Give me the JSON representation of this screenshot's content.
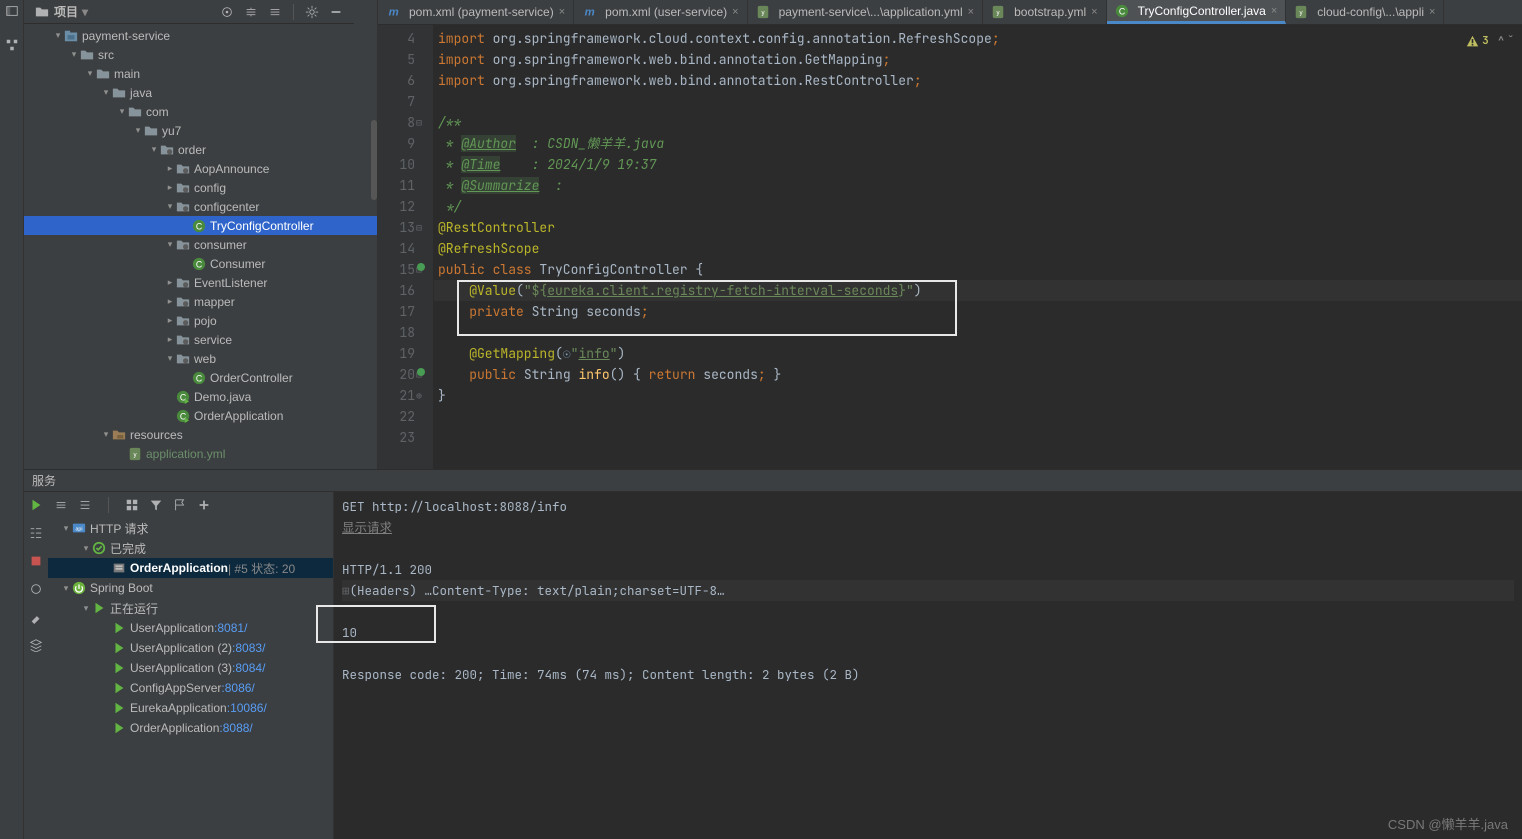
{
  "toolbar": {
    "project_label": "项目"
  },
  "warning_count": "3",
  "project_tree": [
    {
      "d": 0,
      "exp": "▾",
      "icon": "module",
      "label": "payment-service",
      "cls": ""
    },
    {
      "d": 1,
      "exp": "▾",
      "icon": "dir",
      "label": "src",
      "cls": ""
    },
    {
      "d": 2,
      "exp": "▾",
      "icon": "dir",
      "label": "main",
      "cls": ""
    },
    {
      "d": 3,
      "exp": "▾",
      "icon": "dir",
      "label": "java",
      "cls": ""
    },
    {
      "d": 4,
      "exp": "▾",
      "icon": "dir",
      "label": "com",
      "cls": ""
    },
    {
      "d": 5,
      "exp": "▾",
      "icon": "dir",
      "label": "yu7",
      "cls": ""
    },
    {
      "d": 6,
      "exp": "▾",
      "icon": "pkg",
      "label": "order",
      "cls": ""
    },
    {
      "d": 7,
      "exp": "▸",
      "icon": "pkg",
      "label": "AopAnnounce",
      "cls": ""
    },
    {
      "d": 7,
      "exp": "▸",
      "icon": "pkg",
      "label": "config",
      "cls": ""
    },
    {
      "d": 7,
      "exp": "▾",
      "icon": "pkg",
      "label": "configcenter",
      "cls": ""
    },
    {
      "d": 8,
      "exp": "",
      "icon": "class",
      "label": "TryConfigController",
      "cls": "sel"
    },
    {
      "d": 7,
      "exp": "▾",
      "icon": "pkg",
      "label": "consumer",
      "cls": ""
    },
    {
      "d": 8,
      "exp": "",
      "icon": "class",
      "label": "Consumer",
      "cls": ""
    },
    {
      "d": 7,
      "exp": "▸",
      "icon": "pkg",
      "label": "EventListener",
      "cls": ""
    },
    {
      "d": 7,
      "exp": "▸",
      "icon": "pkg",
      "label": "mapper",
      "cls": ""
    },
    {
      "d": 7,
      "exp": "▸",
      "icon": "pkg",
      "label": "pojo",
      "cls": ""
    },
    {
      "d": 7,
      "exp": "▸",
      "icon": "pkg",
      "label": "service",
      "cls": ""
    },
    {
      "d": 7,
      "exp": "▾",
      "icon": "pkg",
      "label": "web",
      "cls": ""
    },
    {
      "d": 8,
      "exp": "",
      "icon": "class",
      "label": "OrderController",
      "cls": ""
    },
    {
      "d": 7,
      "exp": "",
      "icon": "runclass",
      "label": "Demo.java",
      "cls": ""
    },
    {
      "d": 7,
      "exp": "",
      "icon": "runclass",
      "label": "OrderApplication",
      "cls": ""
    },
    {
      "d": 3,
      "exp": "▾",
      "icon": "res",
      "label": "resources",
      "cls": ""
    },
    {
      "d": 4,
      "exp": "",
      "icon": "yml",
      "label": "application.yml",
      "cls": "dim"
    }
  ],
  "tabs": [
    {
      "icon": "m",
      "label": "pom.xml (payment-service)",
      "active": false
    },
    {
      "icon": "m",
      "label": "pom.xml (user-service)",
      "active": false
    },
    {
      "icon": "yml",
      "label": "payment-service\\...\\application.yml",
      "active": false
    },
    {
      "icon": "yml",
      "label": "bootstrap.yml",
      "active": false
    },
    {
      "icon": "class",
      "label": "TryConfigController.java",
      "active": true
    },
    {
      "icon": "yml",
      "label": "cloud-config\\...\\appli",
      "active": false
    }
  ],
  "code": {
    "start": 4,
    "lines": [
      {
        "t": "import",
        "txt": "org.springframework.cloud.context.config.annotation.RefreshScope"
      },
      {
        "t": "import",
        "txt": "org.springframework.web.bind.annotation.GetMapping"
      },
      {
        "t": "import",
        "txt": "org.springframework.web.bind.annotation.RestController"
      },
      {
        "t": "blank"
      },
      {
        "t": "docopen"
      },
      {
        "t": "doctag",
        "tag": "@Author",
        "rest": "  : CSDN_懒羊羊.java"
      },
      {
        "t": "doctag",
        "tag": "@Time",
        "rest": "    : 2024/1/9 19:37"
      },
      {
        "t": "doctag",
        "tag": "@Summarize",
        "rest": "  :"
      },
      {
        "t": "docclose"
      },
      {
        "t": "anno",
        "a": "@RestController"
      },
      {
        "t": "anno",
        "a": "@RefreshScope"
      },
      {
        "t": "classdecl",
        "name": "TryConfigController"
      },
      {
        "t": "value",
        "prop": "eureka.client.registry-fetch-interval-seconds"
      },
      {
        "t": "field",
        "type": "String",
        "name": "seconds"
      },
      {
        "t": "blank2"
      },
      {
        "t": "getmap",
        "path": "info"
      },
      {
        "t": "method",
        "ret": "String",
        "name": "info",
        "body": "seconds"
      },
      {
        "t": "closebrace"
      },
      {
        "t": "blank"
      },
      {
        "t": "blank"
      },
      {
        "t": "blank"
      }
    ]
  },
  "services": {
    "title": "服务",
    "tree": [
      {
        "d": 0,
        "exp": "▾",
        "icon": "http",
        "label": "HTTP 请求",
        "cls": ""
      },
      {
        "d": 1,
        "exp": "▾",
        "icon": "ok",
        "label": "已完成",
        "cls": ""
      },
      {
        "d": 2,
        "exp": "",
        "icon": "req",
        "label": "OrderApplication",
        "suffix": "  |  #5 状态: 20",
        "cls": "sel bold"
      },
      {
        "d": 0,
        "exp": "▾",
        "icon": "sb",
        "label": "Spring Boot",
        "cls": ""
      },
      {
        "d": 1,
        "exp": "▾",
        "icon": "run",
        "label": "正在运行",
        "cls": ""
      },
      {
        "d": 2,
        "exp": "",
        "icon": "run",
        "label": "UserApplication",
        "port": ":8081/",
        "cls": ""
      },
      {
        "d": 2,
        "exp": "",
        "icon": "run",
        "label": "UserApplication (2)",
        "port": ":8083/",
        "cls": ""
      },
      {
        "d": 2,
        "exp": "",
        "icon": "run",
        "label": "UserApplication (3)",
        "port": ":8084/",
        "cls": ""
      },
      {
        "d": 2,
        "exp": "",
        "icon": "run",
        "label": "ConfigAppServer",
        "port": ":8086/",
        "cls": ""
      },
      {
        "d": 2,
        "exp": "",
        "icon": "run",
        "label": "EurekaApplication",
        "port": ":10086/",
        "cls": ""
      },
      {
        "d": 2,
        "exp": "",
        "icon": "run",
        "label": "OrderApplication",
        "port": ":8088/",
        "cls": ""
      }
    ],
    "output": {
      "request": "GET http://localhost:8088/info",
      "show_request": "显示请求",
      "status": "HTTP/1.1 200",
      "headers": "(Headers) …Content-Type: text/plain;charset=UTF-8…",
      "body": "10",
      "footer": "Response code: 200; Time: 74ms (74 ms); Content length: 2 bytes (2 B)"
    }
  },
  "watermark": "CSDN @懒羊羊.java"
}
